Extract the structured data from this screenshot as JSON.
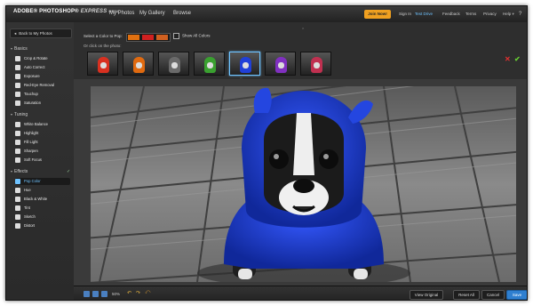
{
  "app": {
    "logo_brand": "ADOBE® PHOTOSHOP®",
    "logo_product": "EXPRESS",
    "logo_tag": "BETA"
  },
  "nav": [
    "My Photos",
    "My Gallery",
    "Browse"
  ],
  "top_links": {
    "join": "Join Now!",
    "sign_in": "Sign In",
    "test_drive": "Test Drive",
    "feedback": "Feedback",
    "terms": "Terms",
    "privacy": "Privacy",
    "help": "Help"
  },
  "sidebar": {
    "back_label": "Back to My Photos",
    "sections": {
      "basics": "Basics",
      "tuning": "Tuning",
      "effects": "Effects"
    },
    "basics_items": [
      "Crop & Rotate",
      "Auto Correct",
      "Exposure",
      "Red-Eye Removal",
      "Touchup",
      "Saturation"
    ],
    "tuning_items": [
      "White Balance",
      "Highlight",
      "Fill Light",
      "Sharpen",
      "Soft Focus"
    ],
    "effects_items": [
      "Pop Color",
      "Hue",
      "Black & White",
      "Tint",
      "Sketch",
      "Distort"
    ],
    "selected_item": "Pop Color"
  },
  "toolbar": {
    "pick_label": "Select a Color to Pop:",
    "click_label": "Or click on the photo:",
    "show_all_label": "Show All Colors",
    "swatch_colors": [
      "#e07010",
      "#d02020",
      "#d06020"
    ],
    "thumb_colors": [
      "#d83020",
      "#e06a10",
      "#6a6a6a",
      "#3aa030",
      "#2040d8",
      "#8030c0",
      "#c03050"
    ],
    "selected_thumb": 4
  },
  "bottombar": {
    "zoom": "50%",
    "view_original": "View Original",
    "reset_all": "Reset All",
    "cancel": "Cancel",
    "save": "Save"
  },
  "colors": {
    "accent": "#6fc3ff",
    "join_button": "#f0a020",
    "save_button": "#2e7fd0",
    "popped_color": "#1f3fd8"
  }
}
